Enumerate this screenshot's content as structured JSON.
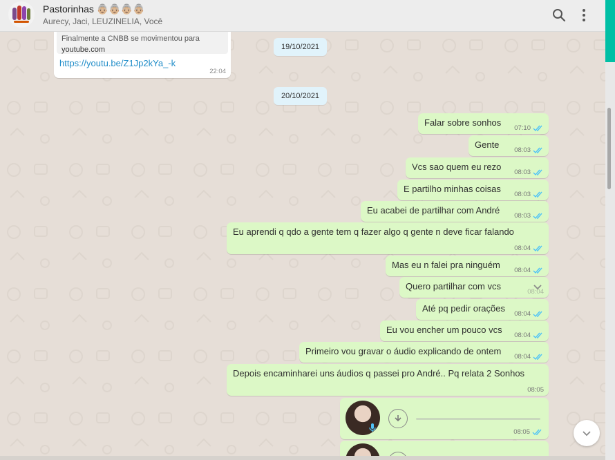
{
  "header": {
    "title": "Pastorinhas 👵🏼👵🏼👵🏼👵🏼",
    "participants": "Aurecy, Jaci, LEUZINELIA, Você",
    "icons": {
      "search": "search-icon",
      "menu": "more-vertical-icon"
    }
  },
  "incoming": {
    "quote_line1": "Finalmente a CNBB se movimentou para",
    "quote_line2": "youtube.com",
    "link": "https://youtu.be/Z1Jp2kYa_-k",
    "time": "22:04"
  },
  "dates": [
    "19/10/2021",
    "20/10/2021"
  ],
  "messages": [
    {
      "text": "Falar sobre sonhos",
      "time": "07:10"
    },
    {
      "text": "Gente",
      "time": "08:03"
    },
    {
      "text": "Vcs sao quem eu rezo",
      "time": "08:03"
    },
    {
      "text": "E partilho minhas coisas",
      "time": "08:03"
    },
    {
      "text": "Eu acabei de partilhar com André",
      "time": "08:03"
    },
    {
      "text": "Eu aprendi q qdo a gente tem q fazer algo q gente n deve ficar falando",
      "time": "08:04"
    },
    {
      "text": "Mas eu n falei pra ninguém",
      "time": "08:04"
    },
    {
      "text": "Quero partilhar com vcs",
      "time": "08:04"
    },
    {
      "text": "Até pq pedir orações",
      "time": "08:04"
    },
    {
      "text": "Eu vou encher um pouco vcs",
      "time": "08:04"
    },
    {
      "text": "Primeiro vou gravar o áudio explicando de ontem",
      "time": "08:04"
    },
    {
      "text": "Depois encaminharei uns áudios q passei pro André.. Pq relata 2 Sonhos",
      "time": "08:05"
    }
  ],
  "audio": [
    {
      "time": "08:05"
    }
  ],
  "colors": {
    "outgoing": "#dcf8c6",
    "date_chip": "#e1f3fb",
    "tick": "#4fc3f7",
    "accent": "#00bfa5"
  }
}
